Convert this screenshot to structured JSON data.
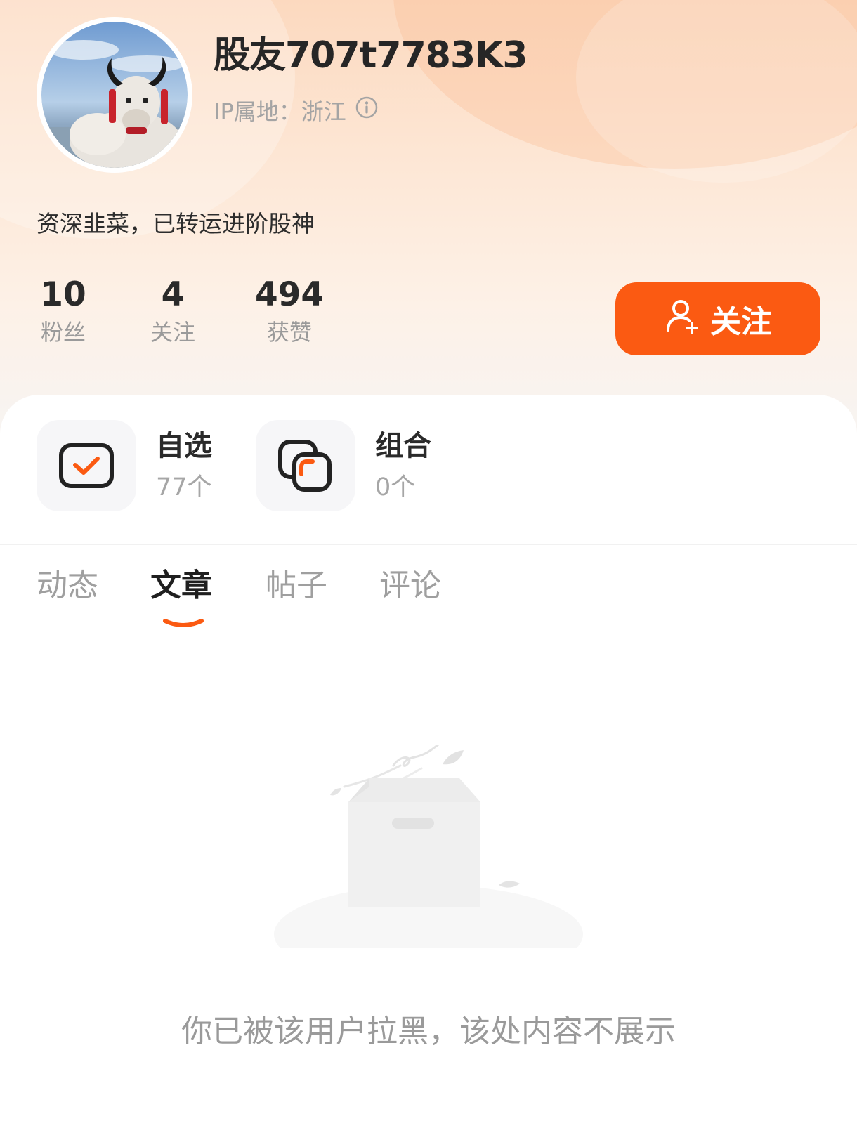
{
  "profile": {
    "username": "股友707t7783K3",
    "ip_location": "IP属地：浙江",
    "bio": "资深韭菜，已转运进阶股神",
    "avatar_icon": "yak-avatar"
  },
  "stats": [
    {
      "value": "10",
      "label": "粉丝"
    },
    {
      "value": "4",
      "label": "关注"
    },
    {
      "value": "494",
      "label": "获赞"
    }
  ],
  "follow_button": {
    "label": "关注",
    "color": "#fb5a12"
  },
  "quick_links": [
    {
      "title": "自选",
      "count": "77个",
      "icon": "checkbox-icon"
    },
    {
      "title": "组合",
      "count": "0个",
      "icon": "portfolio-icon"
    }
  ],
  "tabs": [
    {
      "label": "动态",
      "active": false
    },
    {
      "label": "文章",
      "active": true
    },
    {
      "label": "帖子",
      "active": false
    },
    {
      "label": "评论",
      "active": false
    }
  ],
  "empty_state": {
    "message": "你已被该用户拉黑，该处内容不展示",
    "icon": "empty-box-illustration"
  }
}
